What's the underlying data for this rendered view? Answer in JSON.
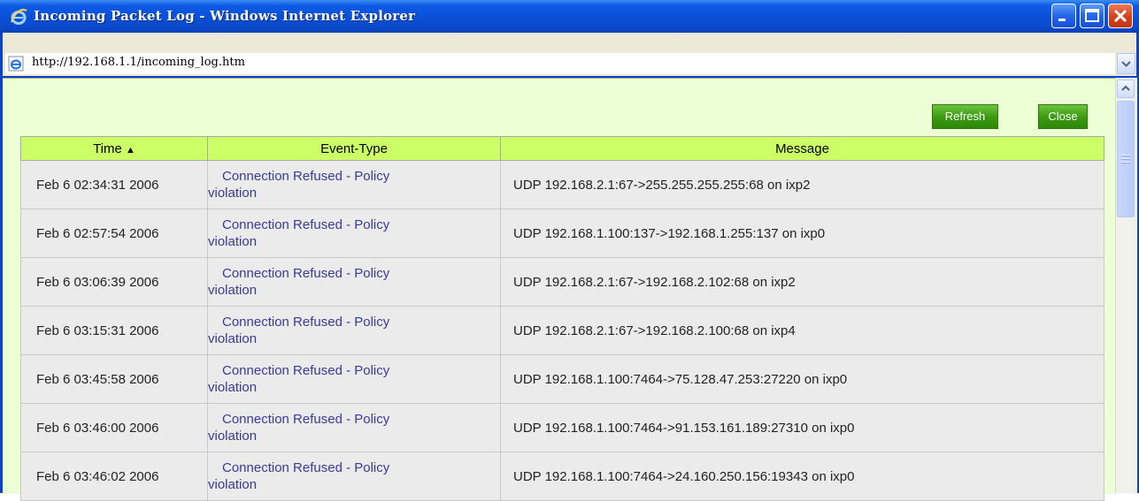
{
  "window": {
    "title": "Incoming Packet Log - Windows Internet Explorer",
    "url": "http://192.168.1.1/incoming_log.htm"
  },
  "toolbar": {
    "refresh_label": "Refresh",
    "close_label": "Close"
  },
  "table": {
    "headers": {
      "time": "Time",
      "sort_indicator": "▲",
      "event_type": "Event-Type",
      "message": "Message"
    },
    "rows": [
      {
        "time": "Feb 6 02:34:31 2006",
        "event_line1": "Connection Refused - Policy",
        "event_line2": "violation",
        "message": "UDP 192.168.2.1:67->255.255.255.255:68 on ixp2"
      },
      {
        "time": "Feb 6 02:57:54 2006",
        "event_line1": "Connection Refused - Policy",
        "event_line2": "violation",
        "message": "UDP 192.168.1.100:137->192.168.1.255:137 on ixp0"
      },
      {
        "time": "Feb 6 03:06:39 2006",
        "event_line1": "Connection Refused - Policy",
        "event_line2": "violation",
        "message": "UDP 192.168.2.1:67->192.168.2.102:68 on ixp2"
      },
      {
        "time": "Feb 6 03:15:31 2006",
        "event_line1": "Connection Refused - Policy",
        "event_line2": "violation",
        "message": "UDP 192.168.2.1:67->192.168.2.100:68 on ixp4"
      },
      {
        "time": "Feb 6 03:45:58 2006",
        "event_line1": "Connection Refused - Policy",
        "event_line2": "violation",
        "message": "UDP 192.168.1.100:7464->75.128.47.253:27220 on ixp0"
      },
      {
        "time": "Feb 6 03:46:00 2006",
        "event_line1": "Connection Refused - Policy",
        "event_line2": "violation",
        "message": "UDP 192.168.1.100:7464->91.153.161.189:27310 on ixp0"
      },
      {
        "time": "Feb 6 03:46:02 2006",
        "event_line1": "Connection Refused - Policy",
        "event_line2": "violation",
        "message": "UDP 192.168.1.100:7464->24.160.250.156:19343 on ixp0"
      }
    ]
  },
  "colors": {
    "titlebar": "#0a4fd6",
    "content_background": "#edffd4",
    "header_background": "#ccff66",
    "button_green": "#39990f",
    "event_text": "#3a3a9a"
  },
  "icons": {
    "title": "ie-logo-icon",
    "address": "ie-page-icon",
    "minimize": "minimize-icon",
    "maximize": "maximize-icon",
    "close": "close-icon"
  }
}
